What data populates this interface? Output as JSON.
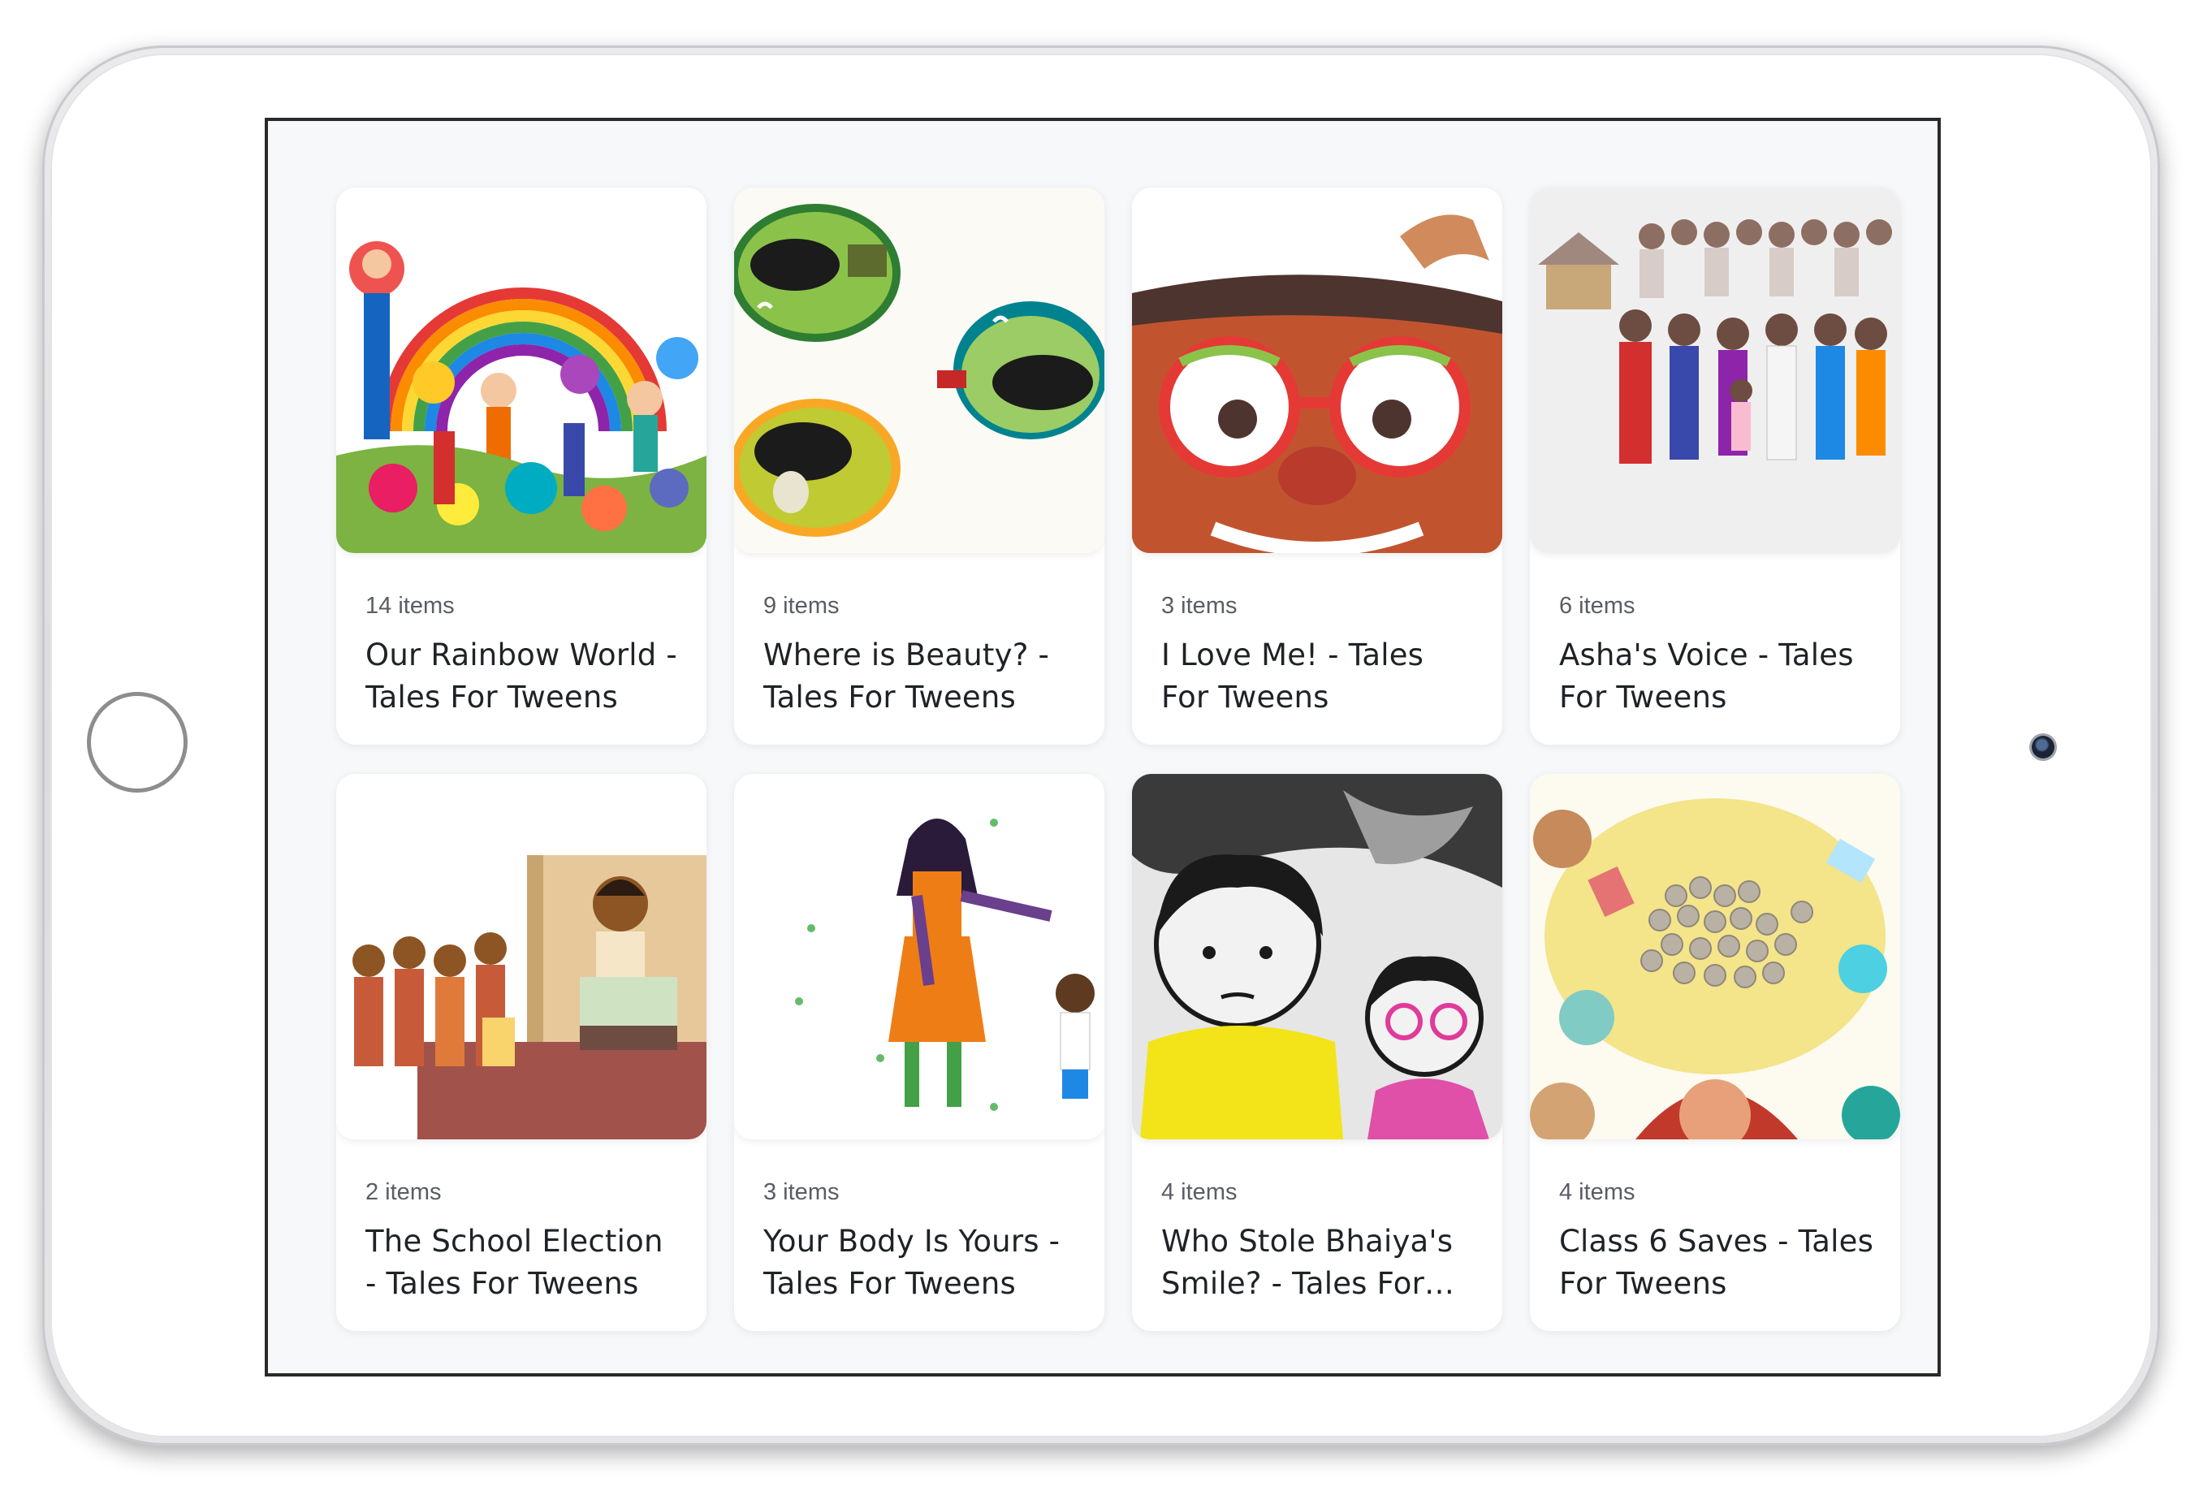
{
  "collections": [
    {
      "count": "14 items",
      "title": "Our Rainbow World - Tales For Tweens",
      "image": "rainbow-world-illustration"
    },
    {
      "count": "9 items",
      "title": "Where is Beauty? - Tales For Tweens",
      "image": "buffalo-ovals-illustration"
    },
    {
      "count": "3 items",
      "title": "I Love Me! - Tales For Tweens",
      "image": "face-red-glasses-illustration"
    },
    {
      "count": "6 items",
      "title": "Asha's Voice - Tales For Tweens",
      "image": "village-crowd-illustration"
    },
    {
      "count": "2 items",
      "title": "The School Election - Tales For Tweens",
      "image": "voting-booth-illustration"
    },
    {
      "count": "3 items",
      "title": "Your Body Is Yours - Tales For Tweens",
      "image": "girl-and-boy-illustration"
    },
    {
      "count": "4 items",
      "title": "Who Stole Bhaiya's Smile? - Tales For Tweens",
      "image": "brother-sister-illustration"
    },
    {
      "count": "4 items",
      "title": "Class 6 Saves - Tales For Tweens",
      "image": "coins-table-illustration"
    }
  ]
}
